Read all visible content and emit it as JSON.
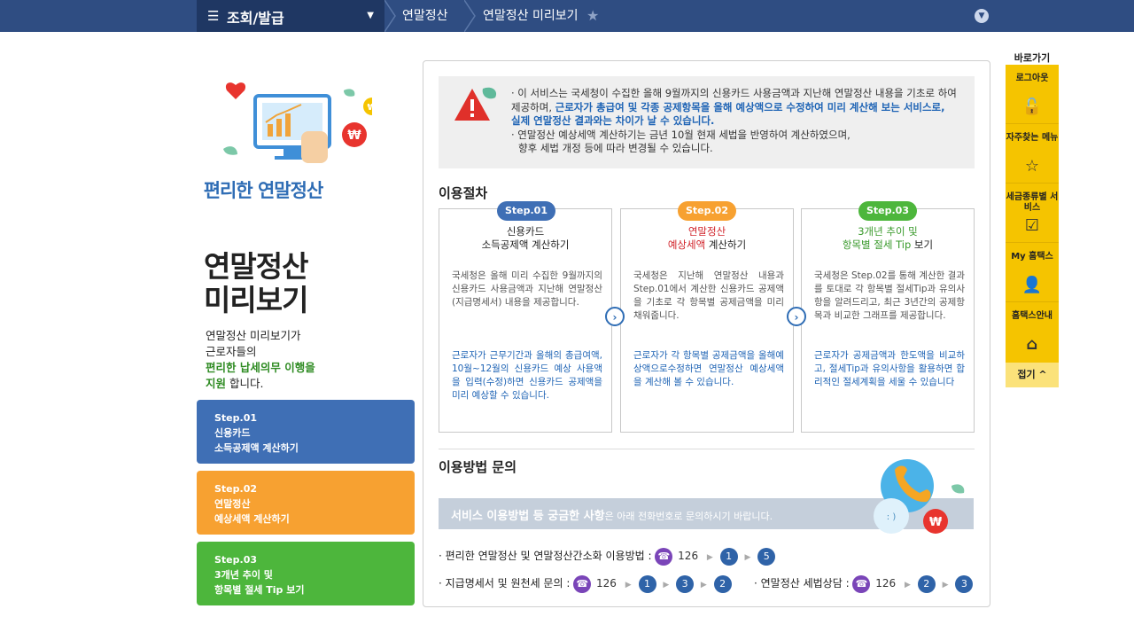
{
  "topbar": {
    "menu_title": "조회/발급",
    "crumbs": [
      "연말정산",
      "연말정산 미리보기"
    ]
  },
  "left": {
    "hero_title": "편리한 연말정산",
    "big_title_1": "연말정산",
    "big_title_2": "미리보기",
    "desc_1": "연말정산 미리보기가",
    "desc_2": "근로자들의",
    "desc_3": "편리한 납세의무 이행을",
    "desc_4a": "지원",
    "desc_4b": " 합니다.",
    "steps": [
      {
        "l1": "Step.01",
        "l2": "신용카드",
        "l3": "소득공제액 계산하기",
        "color": "#3f6fb5"
      },
      {
        "l1": "Step.02",
        "l2": "연말정산",
        "l3": "예상세액 계산하기",
        "color": "#f7a131"
      },
      {
        "l1": "Step.03",
        "l2": "3개년 추이 및",
        "l3": "항목별 절세 Tip 보기",
        "color": "#4db63c"
      }
    ]
  },
  "notice": {
    "l1": "· 이 서비스는 국세청이 수집한 올해 9월까지의 신용카드 사용금액과 지난해 연말정산 내용을 기초로 하여",
    "l2a": "제공하며, ",
    "l2b": "근로자가 총급여 및 각종 공제항목을 올해 예상액으로 수정하여 미리 계산해 보는 서비스로,",
    "l3": "실제 연말정산 결과와는 차이가 날 수 있습니다.",
    "l4": "· 연말정산 예상세액 계산하기는 금년 10월 현재 세법을 반영하여 계산하였으며,",
    "l5": "향후 세법 개정 등에 따라 변경될 수 있습니다."
  },
  "procedure": {
    "title": "이용절차",
    "cards": [
      {
        "pill": "Step.01",
        "pill_color": "#3f6fb5",
        "h1": "신용카드",
        "h2": "소득공제액 계산하기",
        "body": "국세청은 올해 미리 수집한 9월까지의 신용카드 사용금액과 지난해 연말정산(지급명세서) 내용을 제공합니다.",
        "tip": "근로자가 근무기간과 올해의 총급여액, 10월~12월의 신용카드 예상 사용액을 입력(수정)하면 신용카드 공제액을 미리 예상할 수 있습니다."
      },
      {
        "pill": "Step.02",
        "pill_color": "#f7a131",
        "h1": "연말정산",
        "h2a": "예상세액",
        "h2b": " 계산하기",
        "body": "국세청은 지난해 연말정산 내용과 Step.01에서 계산한 신용카드 공제액을 기초로 각 항목별 공제금액을 미리 채워줍니다.",
        "tip": "근로자가 각 항목별 공제금액을 올해예상액으로수정하면 연말정산 예상세액을 계산해 볼 수 있습니다."
      },
      {
        "pill": "Step.03",
        "pill_color": "#4db63c",
        "h1": "3개년 추이 및",
        "h2a": "항목별 절세 Tip",
        "h2b": " 보기",
        "body": "국세청은 Step.02를 통해 계산한 결과를 토대로 각 항목별 절세Tip과 유의사항을 알려드리고, 최근 3년간의 공제항목과 비교한 그래프를 제공합니다.",
        "tip": "근로자가 공제금액과 한도액을 비교하고, 절세Tip과 유의사항을 활용하면 합리적인 절세계획을 세울 수 있습니다"
      }
    ]
  },
  "inquiry": {
    "title": "이용방법 문의",
    "banner_bold": "서비스 이용방법 등 궁금한 사항",
    "banner_rest": "은 아래 전화번호로 문의하시기 바랍니다.",
    "line1_label": "· 편리한 연말정산 및 연말정산간소화 이용방법 :",
    "line2_label": "· 지급명세서 및 원천세 문의 :",
    "line3_label": "· 연말정산 세법상담  :",
    "phone": "126",
    "line1_nums": [
      "1",
      "5"
    ],
    "line2_nums": [
      "1",
      "3",
      "2"
    ],
    "line3_nums": [
      "2",
      "3"
    ]
  },
  "quick": {
    "title": "바로가기",
    "items": [
      {
        "label": "로그아웃",
        "icon": "unlock-icon"
      },
      {
        "label": "자주찾는 메뉴",
        "icon": "star-icon"
      },
      {
        "label": "세금종류별 서비스",
        "icon": "checkbox-icon"
      },
      {
        "label": "My 홈택스",
        "icon": "user-icon"
      },
      {
        "label": "홈택스안내",
        "icon": "house-icon"
      }
    ],
    "close": "접기 ^"
  }
}
